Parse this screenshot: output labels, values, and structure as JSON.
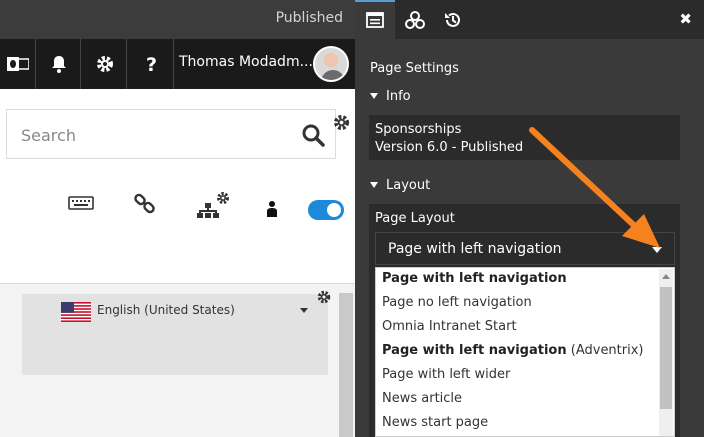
{
  "app": {
    "status": "Published",
    "user_name": "Thomas Modadm..."
  },
  "search": {
    "placeholder": "Search"
  },
  "language": {
    "selected": "English (United States)"
  },
  "panel": {
    "tabs": [
      {
        "icon": "page-settings-icon",
        "active": true
      },
      {
        "icon": "apps-cubes-icon",
        "active": false
      },
      {
        "icon": "history-icon",
        "active": false
      }
    ],
    "close_label": "✖",
    "title": "Page Settings",
    "info_section": "Info",
    "info_lines": [
      "Sponsorships",
      "Version 6.0 - Published"
    ],
    "layout_section": "Layout",
    "page_layout_label": "Page Layout",
    "page_layout_value": "Page with left navigation",
    "options": [
      {
        "bold": "Page with left navigation",
        "rest": ""
      },
      {
        "bold": "",
        "rest": "Page no left navigation"
      },
      {
        "bold": "",
        "rest": "Omnia Intranet Start"
      },
      {
        "bold": "Page with left navigation",
        "rest": " (Adventrix)"
      },
      {
        "bold": "",
        "rest": "Page with left wider"
      },
      {
        "bold": "",
        "rest": "News article"
      },
      {
        "bold": "",
        "rest": "News start page"
      }
    ]
  },
  "colors": {
    "accent": "#1e88d9",
    "panel_bg": "#3a3a3a",
    "annotation_arrow": "#f5821f"
  }
}
